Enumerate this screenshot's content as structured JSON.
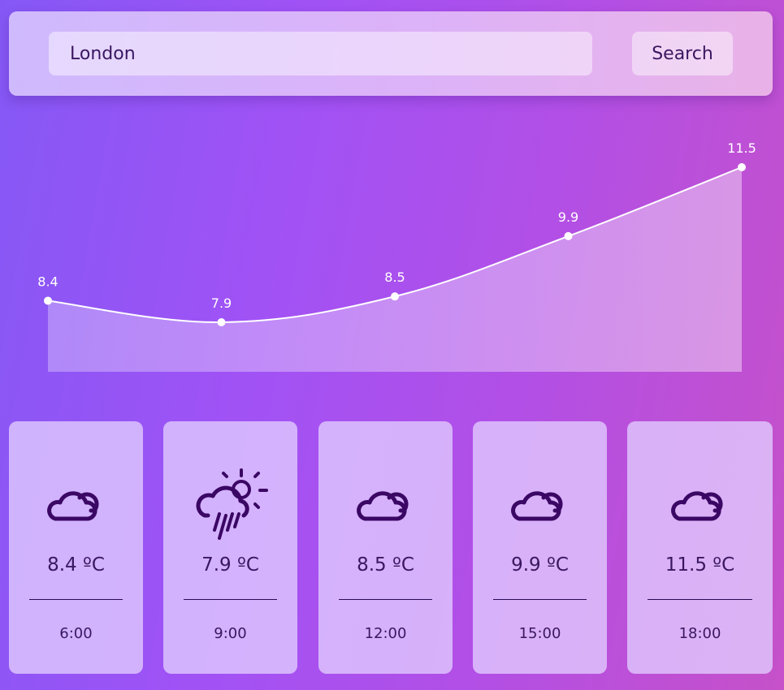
{
  "search": {
    "value": "London",
    "button_label": "Search"
  },
  "chart_data": {
    "type": "area",
    "x": [
      "6:00",
      "9:00",
      "12:00",
      "15:00",
      "18:00"
    ],
    "values": [
      8.4,
      7.9,
      8.5,
      9.9,
      11.5
    ],
    "data_labels": [
      "8.4",
      "7.9",
      "8.5",
      "9.9",
      "11.5"
    ],
    "title": "",
    "xlabel": "",
    "ylabel": "",
    "grid": false,
    "colors": {
      "line": "#ffffff",
      "fill": "#ffffff"
    }
  },
  "forecast": [
    {
      "temp": "8.4 ºC",
      "time": "6:00",
      "icon": "cloudy-icon"
    },
    {
      "temp": "7.9 ºC",
      "time": "9:00",
      "icon": "sun-rain-icon"
    },
    {
      "temp": "8.5 ºC",
      "time": "12:00",
      "icon": "cloudy-icon"
    },
    {
      "temp": "9.9 ºC",
      "time": "15:00",
      "icon": "cloudy-icon"
    },
    {
      "temp": "11.5 ºC",
      "time": "18:00",
      "icon": "cloudy-icon"
    }
  ],
  "colors": {
    "icon": "#3b0764",
    "text": "#3a1760"
  }
}
